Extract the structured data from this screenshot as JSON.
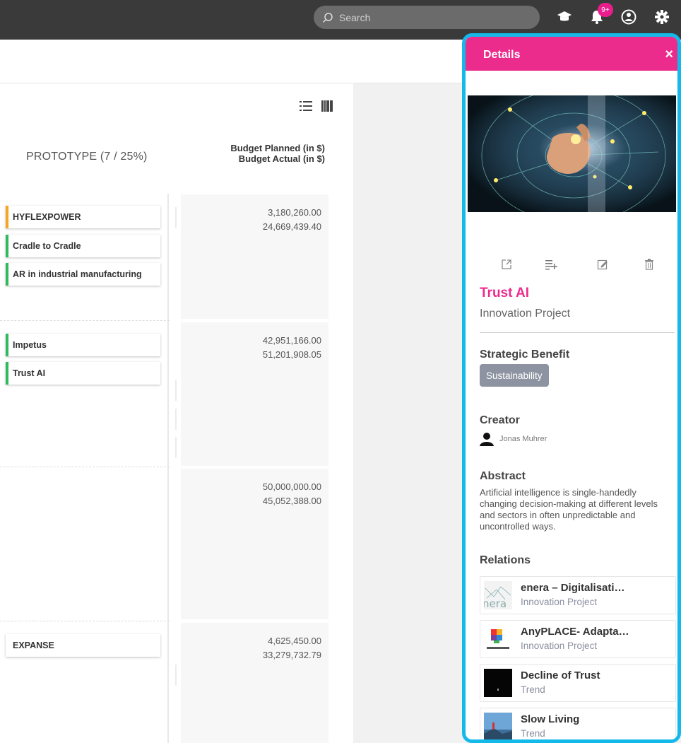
{
  "topbar": {
    "search_placeholder": "Search",
    "notification_count": "9+",
    "icons": [
      "graduation-cap-icon",
      "bell-icon",
      "user-circle-icon",
      "gear-icon"
    ]
  },
  "board": {
    "column_title": "PROTOTYPE (7 / 25%)",
    "budget_header_line1": "Budget Planned (in $)",
    "budget_header_line2": "Budget Actual (in $)",
    "rows": [
      {
        "cards": [
          {
            "label": "HYFLEXPOWER",
            "color": "#f5a623"
          },
          {
            "label": "Cradle to Cradle",
            "color": "#2dbb5d"
          },
          {
            "label": "AR in industrial manufacturing",
            "color": "#2dbb5d"
          }
        ],
        "planned": "3,180,260.00",
        "actual": "24,669,439.40"
      },
      {
        "cards": [
          {
            "label": "Impetus",
            "color": "#2dbb5d"
          },
          {
            "label": "Trust AI",
            "color": "#2dbb5d"
          }
        ],
        "planned": "42,951,166.00",
        "actual": "51,201,908.05"
      },
      {
        "cards": [],
        "planned": "50,000,000.00",
        "actual": "45,052,388.00"
      },
      {
        "cards": [
          {
            "label": "EXPANSE",
            "color": null
          }
        ],
        "planned": "4,625,450.00",
        "actual": "33,279,732.79"
      }
    ]
  },
  "details": {
    "header": "Details",
    "close": "×",
    "title": "Trust AI",
    "type": "Innovation Project",
    "strategic_benefit_label": "Strategic Benefit",
    "strategic_benefit": "Sustainability",
    "creator_label": "Creator",
    "creator": "Jonas Muhrer",
    "abstract_label": "Abstract",
    "abstract": "Artificial intelligence is single-handedly changing decision-making at different levels and sectors in often unpredictable and uncontrolled ways.",
    "relations_label": "Relations",
    "relations": [
      {
        "title": "enera – Digitalisati…",
        "type": "Innovation Project"
      },
      {
        "title": "AnyPLACE- Adapta…",
        "type": "Innovation Project"
      },
      {
        "title": "Decline of Trust",
        "type": "Trend"
      },
      {
        "title": "Slow Living",
        "type": "Trend"
      }
    ]
  },
  "colors": {
    "accent_pink": "#ec2c8d",
    "highlight_border": "#14b9ea",
    "topbar": "#3a3a3a",
    "chip": "#8d93a0"
  }
}
